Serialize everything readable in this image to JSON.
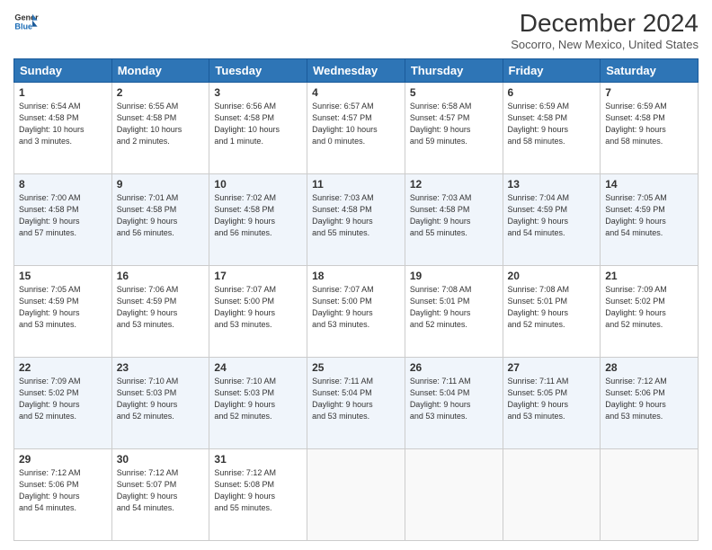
{
  "header": {
    "logo_line1": "General",
    "logo_line2": "Blue",
    "main_title": "December 2024",
    "subtitle": "Socorro, New Mexico, United States"
  },
  "calendar": {
    "days_of_week": [
      "Sunday",
      "Monday",
      "Tuesday",
      "Wednesday",
      "Thursday",
      "Friday",
      "Saturday"
    ],
    "weeks": [
      [
        {
          "day": "",
          "empty": true
        },
        {
          "day": "",
          "empty": true
        },
        {
          "day": "",
          "empty": true
        },
        {
          "day": "",
          "empty": true
        },
        {
          "day": "",
          "empty": true
        },
        {
          "day": "",
          "empty": true
        },
        {
          "day": "",
          "empty": true
        }
      ],
      [
        {
          "day": "1",
          "sunrise": "6:54 AM",
          "sunset": "4:58 PM",
          "daylight": "10 hours and 3 minutes."
        },
        {
          "day": "2",
          "sunrise": "6:55 AM",
          "sunset": "4:58 PM",
          "daylight": "10 hours and 2 minutes."
        },
        {
          "day": "3",
          "sunrise": "6:56 AM",
          "sunset": "4:58 PM",
          "daylight": "10 hours and 1 minute."
        },
        {
          "day": "4",
          "sunrise": "6:57 AM",
          "sunset": "4:57 PM",
          "daylight": "10 hours and 0 minutes."
        },
        {
          "day": "5",
          "sunrise": "6:58 AM",
          "sunset": "4:57 PM",
          "daylight": "9 hours and 59 minutes."
        },
        {
          "day": "6",
          "sunrise": "6:59 AM",
          "sunset": "4:58 PM",
          "daylight": "9 hours and 58 minutes."
        },
        {
          "day": "7",
          "sunrise": "6:59 AM",
          "sunset": "4:58 PM",
          "daylight": "9 hours and 58 minutes."
        }
      ],
      [
        {
          "day": "8",
          "sunrise": "7:00 AM",
          "sunset": "4:58 PM",
          "daylight": "9 hours and 57 minutes."
        },
        {
          "day": "9",
          "sunrise": "7:01 AM",
          "sunset": "4:58 PM",
          "daylight": "9 hours and 56 minutes."
        },
        {
          "day": "10",
          "sunrise": "7:02 AM",
          "sunset": "4:58 PM",
          "daylight": "9 hours and 56 minutes."
        },
        {
          "day": "11",
          "sunrise": "7:03 AM",
          "sunset": "4:58 PM",
          "daylight": "9 hours and 55 minutes."
        },
        {
          "day": "12",
          "sunrise": "7:03 AM",
          "sunset": "4:58 PM",
          "daylight": "9 hours and 55 minutes."
        },
        {
          "day": "13",
          "sunrise": "7:04 AM",
          "sunset": "4:59 PM",
          "daylight": "9 hours and 54 minutes."
        },
        {
          "day": "14",
          "sunrise": "7:05 AM",
          "sunset": "4:59 PM",
          "daylight": "9 hours and 54 minutes."
        }
      ],
      [
        {
          "day": "15",
          "sunrise": "7:05 AM",
          "sunset": "4:59 PM",
          "daylight": "9 hours and 53 minutes."
        },
        {
          "day": "16",
          "sunrise": "7:06 AM",
          "sunset": "4:59 PM",
          "daylight": "9 hours and 53 minutes."
        },
        {
          "day": "17",
          "sunrise": "7:07 AM",
          "sunset": "5:00 PM",
          "daylight": "9 hours and 53 minutes."
        },
        {
          "day": "18",
          "sunrise": "7:07 AM",
          "sunset": "5:00 PM",
          "daylight": "9 hours and 53 minutes."
        },
        {
          "day": "19",
          "sunrise": "7:08 AM",
          "sunset": "5:01 PM",
          "daylight": "9 hours and 52 minutes."
        },
        {
          "day": "20",
          "sunrise": "7:08 AM",
          "sunset": "5:01 PM",
          "daylight": "9 hours and 52 minutes."
        },
        {
          "day": "21",
          "sunrise": "7:09 AM",
          "sunset": "5:02 PM",
          "daylight": "9 hours and 52 minutes."
        }
      ],
      [
        {
          "day": "22",
          "sunrise": "7:09 AM",
          "sunset": "5:02 PM",
          "daylight": "9 hours and 52 minutes."
        },
        {
          "day": "23",
          "sunrise": "7:10 AM",
          "sunset": "5:03 PM",
          "daylight": "9 hours and 52 minutes."
        },
        {
          "day": "24",
          "sunrise": "7:10 AM",
          "sunset": "5:03 PM",
          "daylight": "9 hours and 52 minutes."
        },
        {
          "day": "25",
          "sunrise": "7:11 AM",
          "sunset": "5:04 PM",
          "daylight": "9 hours and 53 minutes."
        },
        {
          "day": "26",
          "sunrise": "7:11 AM",
          "sunset": "5:04 PM",
          "daylight": "9 hours and 53 minutes."
        },
        {
          "day": "27",
          "sunrise": "7:11 AM",
          "sunset": "5:05 PM",
          "daylight": "9 hours and 53 minutes."
        },
        {
          "day": "28",
          "sunrise": "7:12 AM",
          "sunset": "5:06 PM",
          "daylight": "9 hours and 53 minutes."
        }
      ],
      [
        {
          "day": "29",
          "sunrise": "7:12 AM",
          "sunset": "5:06 PM",
          "daylight": "9 hours and 54 minutes."
        },
        {
          "day": "30",
          "sunrise": "7:12 AM",
          "sunset": "5:07 PM",
          "daylight": "9 hours and 54 minutes."
        },
        {
          "day": "31",
          "sunrise": "7:12 AM",
          "sunset": "5:08 PM",
          "daylight": "9 hours and 55 minutes."
        },
        {
          "day": "",
          "empty": true
        },
        {
          "day": "",
          "empty": true
        },
        {
          "day": "",
          "empty": true
        },
        {
          "day": "",
          "empty": true
        }
      ]
    ],
    "labels": {
      "sunrise": "Sunrise:",
      "sunset": "Sunset:",
      "daylight": "Daylight hours"
    }
  }
}
